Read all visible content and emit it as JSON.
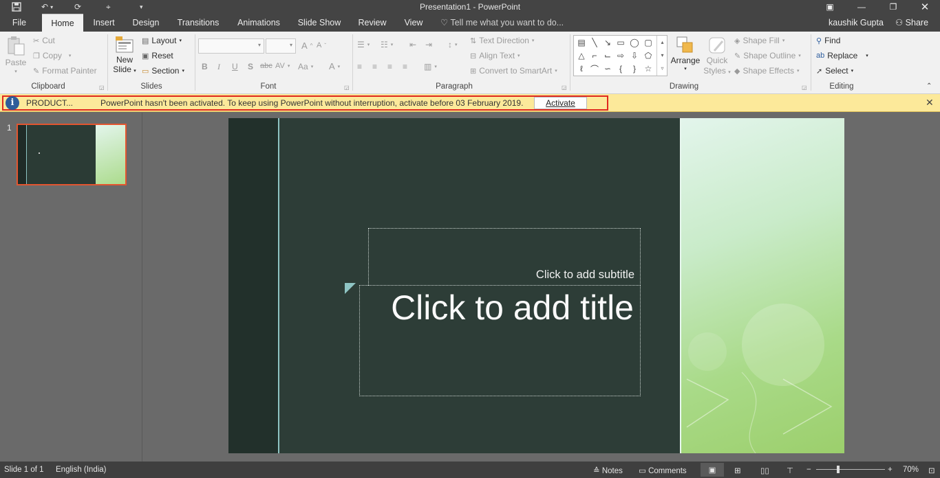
{
  "window": {
    "title": "Presentation1 - PowerPoint",
    "user": "kaushik Gupta",
    "share_label": "Share"
  },
  "tabs": [
    "File",
    "Home",
    "Insert",
    "Design",
    "Transitions",
    "Animations",
    "Slide Show",
    "Review",
    "View"
  ],
  "tell_me": "Tell me what you want to do...",
  "ribbon": {
    "clipboard": {
      "paste": "Paste",
      "cut": "Cut",
      "copy": "Copy",
      "format_painter": "Format Painter",
      "label": "Clipboard"
    },
    "slides": {
      "new_slide_1": "New",
      "new_slide_2": "Slide",
      "layout": "Layout",
      "reset": "Reset",
      "section": "Section",
      "label": "Slides"
    },
    "font": {
      "label": "Font",
      "bold": "B",
      "italic": "I",
      "underline": "U",
      "strike": "S",
      "abc": "abc",
      "av": "AV",
      "aa": "Aa",
      "a": "A"
    },
    "paragraph": {
      "text_direction": "Text Direction",
      "align_text": "Align Text",
      "convert_smartart": "Convert to SmartArt",
      "label": "Paragraph"
    },
    "drawing": {
      "arrange": "Arrange",
      "quick_styles_1": "Quick",
      "quick_styles_2": "Styles",
      "shape_fill": "Shape Fill",
      "shape_outline": "Shape Outline",
      "shape_effects": "Shape Effects",
      "label": "Drawing"
    },
    "editing": {
      "find": "Find",
      "replace": "Replace",
      "select": "Select",
      "label": "Editing"
    }
  },
  "notification": {
    "tag": "PRODUCT...",
    "message": "PowerPoint hasn't been activated. To keep using PowerPoint without interruption, activate before 03 February 2019.",
    "button": "Activate"
  },
  "thumbnails": [
    {
      "number": "1"
    }
  ],
  "slide": {
    "subtitle_placeholder": "Click to add subtitle",
    "title_placeholder": "Click to add title"
  },
  "status": {
    "slide_count": "Slide 1 of 1",
    "language": "English (India)",
    "notes": "Notes",
    "comments": "Comments",
    "zoom": "70%"
  }
}
